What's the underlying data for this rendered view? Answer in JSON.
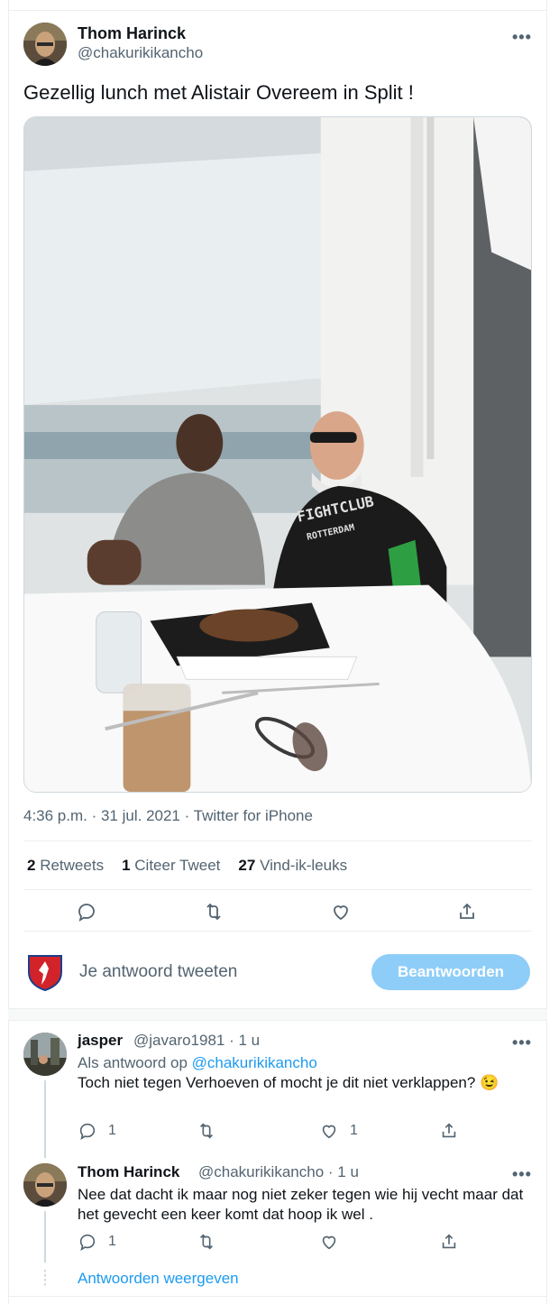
{
  "main_tweet": {
    "author_name": "Thom Harinck",
    "author_handle": "@chakurikikancho",
    "text": "Gezellig lunch met Alistair Overeem in Split !",
    "meta": "4:36 p.m. · 31 jul. 2021 · Twitter for iPhone",
    "stats": {
      "retweets_count": "2",
      "retweets_label": "Retweets",
      "quotes_count": "1",
      "quotes_label": "Citeer Tweet",
      "likes_count": "27",
      "likes_label": "Vind-ik-leuks"
    },
    "photo_shirt_text_1": "FIGHTCLUB",
    "photo_shirt_text_2": "ROTTERDAM"
  },
  "compose": {
    "placeholder": "Je antwoord tweeten",
    "button_label": "Beantwoorden"
  },
  "replies": [
    {
      "author_name": "jasper",
      "author_handle": "@javaro1981 · 1 u",
      "reply_to_prefix": "Als antwoord op",
      "reply_to_handle": "@chakurikikancho",
      "text": "Toch niet tegen Verhoeven of mocht je dit niet verklappen?",
      "emoji": "😉",
      "reply_count": "1",
      "like_count": "1"
    },
    {
      "author_name": "Thom Harinck",
      "author_handle": "@chakurikikancho · 1 u",
      "text": "Nee dat dacht ik maar nog niet zeker tegen wie hij vecht maar dat het gevecht een keer komt dat hoop ik wel .",
      "reply_count": "1"
    }
  ],
  "show_replies_label": "Antwoorden weergeven",
  "more_label": "•••",
  "colors": {
    "accent": "#1d9bf0",
    "button_disabled": "#8ecdf8",
    "secondary_text": "#536471"
  }
}
